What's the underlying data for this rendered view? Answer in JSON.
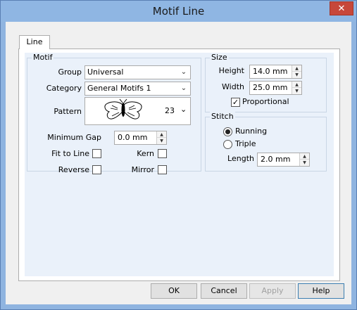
{
  "window": {
    "title": "Motif Line",
    "close_glyph": "✕"
  },
  "tabs": [
    {
      "label": "Line"
    }
  ],
  "motif": {
    "group_title": "Motif",
    "group_label": "Group",
    "group_value": "Universal",
    "category_label": "Category",
    "category_value": "General Motifs 1",
    "pattern_label": "Pattern",
    "pattern_number": "23",
    "pattern_icon": "butterfly-icon",
    "min_gap_label": "Minimum Gap",
    "min_gap_value": "0.0 mm",
    "fit_to_line_label": "Fit to Line",
    "fit_to_line_checked": false,
    "kern_label": "Kern",
    "kern_checked": false,
    "reverse_label": "Reverse",
    "reverse_checked": false,
    "mirror_label": "Mirror",
    "mirror_checked": false
  },
  "size": {
    "group_title": "Size",
    "height_label": "Height",
    "height_value": "14.0 mm",
    "width_label": "Width",
    "width_value": "25.0 mm",
    "proportional_label": "Proportional",
    "proportional_checked": true
  },
  "stitch": {
    "group_title": "Stitch",
    "running_label": "Running",
    "triple_label": "Triple",
    "selected": "Running",
    "length_label": "Length",
    "length_value": "2.0 mm"
  },
  "buttons": {
    "ok": "OK",
    "cancel": "Cancel",
    "apply": "Apply",
    "help": "Help"
  },
  "glyphs": {
    "check": "✓",
    "chevron_down": "⌄",
    "spin_up": "▲",
    "spin_down": "▼"
  }
}
